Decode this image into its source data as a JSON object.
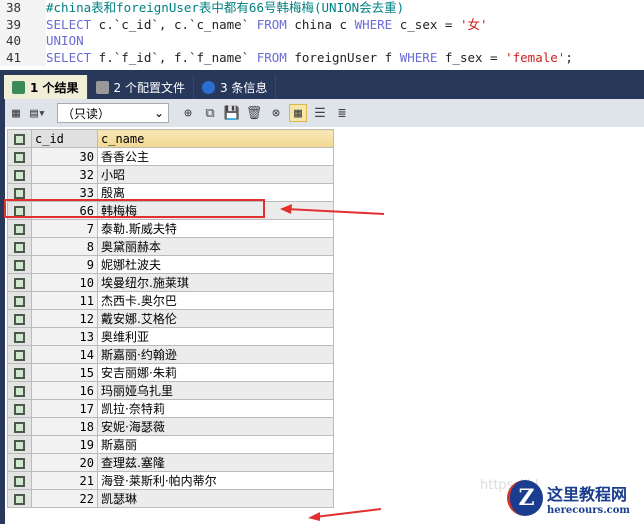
{
  "editor": {
    "lines": [
      {
        "n": "38",
        "comment": "#china表和foreignUser表中都有66号韩梅梅(UNION会去重)"
      },
      {
        "n": "39",
        "select": "SELECT",
        "a": " c.`c_id`, c.`c_name` ",
        "from": "FROM",
        "b": " china c ",
        "where": "WHERE",
        "c": " c_sex = ",
        "s": "'女'"
      },
      {
        "n": "40",
        "union": "UNION"
      },
      {
        "n": "41",
        "select": "SELECT",
        "a": " f.`f_id`, f.`f_name` ",
        "from": "FROM",
        "b": " foreignUser f ",
        "where": "WHERE",
        "c": " f_sex = ",
        "s": "'female'",
        "end": ";"
      }
    ]
  },
  "tabs": [
    {
      "label": "1 个结果"
    },
    {
      "label": "2 个配置文件"
    },
    {
      "label": "3 条信息"
    }
  ],
  "toolbar": {
    "mode": "（只读）"
  },
  "grid": {
    "headers": [
      "c_id",
      "c_name"
    ],
    "rows": [
      [
        "30",
        "香香公主"
      ],
      [
        "32",
        "小昭"
      ],
      [
        "33",
        "殷离"
      ],
      [
        "66",
        "韩梅梅"
      ],
      [
        "7",
        "泰勒.斯威夫特"
      ],
      [
        "8",
        "奥黛丽赫本"
      ],
      [
        "9",
        "妮娜杜波夫"
      ],
      [
        "10",
        "埃曼纽尔.施莱琪"
      ],
      [
        "11",
        "杰西卡.奥尔巴"
      ],
      [
        "12",
        "戴安娜.艾格伦"
      ],
      [
        "13",
        "奥维利亚"
      ],
      [
        "14",
        "斯嘉丽·约翰逊"
      ],
      [
        "15",
        "安吉丽娜·朱莉"
      ],
      [
        "16",
        "玛丽娅乌扎里"
      ],
      [
        "17",
        "凯拉·奈特莉"
      ],
      [
        "18",
        "安妮·海瑟薇"
      ],
      [
        "19",
        "斯嘉丽"
      ],
      [
        "20",
        "查理兹.塞隆"
      ],
      [
        "21",
        "海登·莱斯利·帕内蒂尔"
      ],
      [
        "22",
        "凯瑟琳"
      ]
    ]
  },
  "watermark": {
    "url": "https://bl",
    "logo_cn": "这里教程网",
    "logo_en": "herecours.com"
  },
  "colors": {
    "highlight": "#e03030",
    "tabbar": "#27385a"
  }
}
